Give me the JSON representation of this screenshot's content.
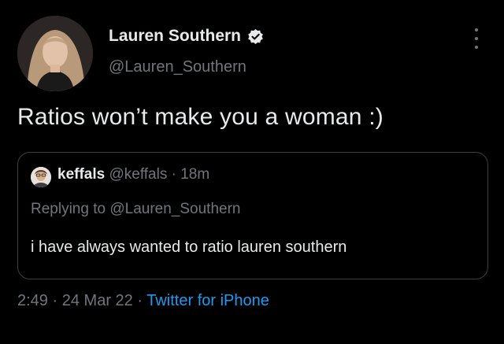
{
  "tweet": {
    "author": {
      "display_name": "Lauren Southern",
      "handle": "@Lauren_Southern",
      "verified": true
    },
    "text": "Ratios won’t make you a woman :)",
    "quoted": {
      "author_name": "keffals",
      "handle": "@keffals",
      "separator": "·",
      "time": "18m",
      "replying_prefix": "Replying to",
      "replying_to": "@Lauren_Southern",
      "text": "i have always wanted to ratio lauren southern"
    },
    "footer": {
      "time": "2:49",
      "separator": "·",
      "date": "24 Mar 22",
      "source": "Twitter for iPhone"
    }
  },
  "icons": {
    "verified": "verified-badge-icon",
    "more": "more-vertical-icon"
  },
  "colors": {
    "background": "#000000",
    "primary_text": "#e7e9ea",
    "secondary_text": "#71767b",
    "link": "#1d9bf0",
    "border": "#3b3f44"
  }
}
